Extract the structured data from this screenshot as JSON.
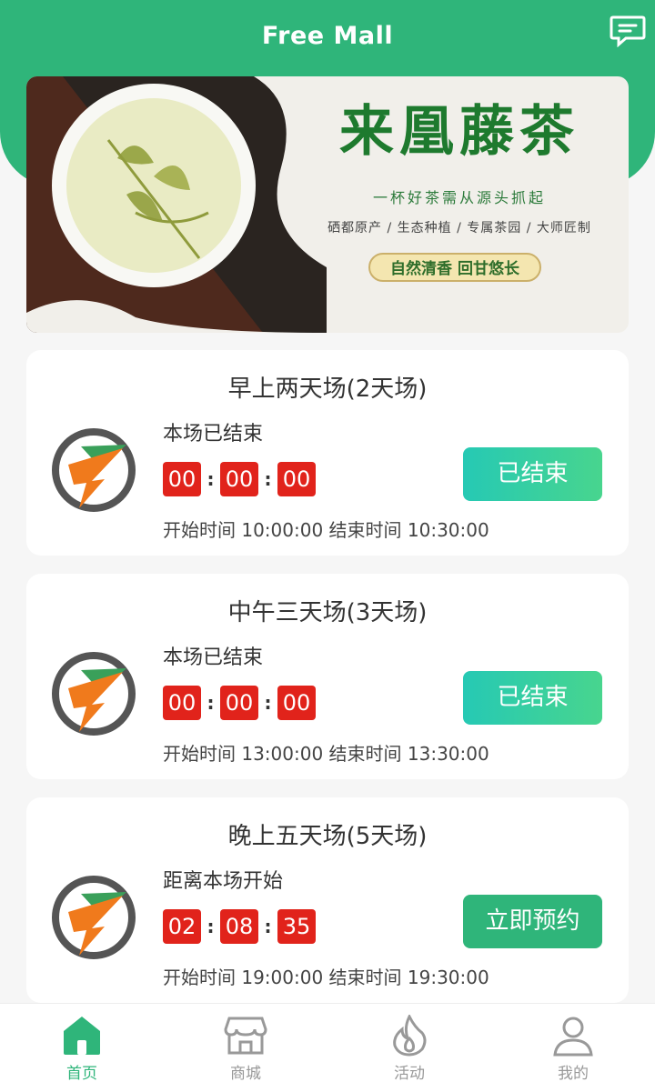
{
  "header": {
    "title": "Free Mall",
    "message_icon": "message-icon"
  },
  "banner": {
    "title": "来凰藤茶",
    "slogan": "一杯好茶需从源头抓起",
    "features": "硒都原产 / 生态种植 / 专属茶园 / 大师匠制",
    "tagline": "自然清香 回甘悠长"
  },
  "sessions": [
    {
      "title": "早上两天场(2天场)",
      "status": "本场已结束",
      "countdown": [
        "00",
        "00",
        "00"
      ],
      "time": "开始时间 10:00:00 结束时间 10:30:00",
      "button": "已结束"
    },
    {
      "title": "中午三天场(3天场)",
      "status": "本场已结束",
      "countdown": [
        "00",
        "00",
        "00"
      ],
      "time": "开始时间 13:00:00 结束时间 13:30:00",
      "button": "已结束"
    },
    {
      "title": "晚上五天场(5天场)",
      "status": "距离本场开始",
      "countdown": [
        "02",
        "08",
        "35"
      ],
      "time": "开始时间 19:00:00 结束时间 19:30:00",
      "button": "立即预约"
    }
  ],
  "tabs": [
    {
      "label": "首页",
      "icon": "home-icon",
      "active": true
    },
    {
      "label": "商城",
      "icon": "store-icon",
      "active": false
    },
    {
      "label": "活动",
      "icon": "fire-icon",
      "active": false
    },
    {
      "label": "我的",
      "icon": "user-icon",
      "active": false
    }
  ],
  "colors": {
    "brand": "#2fb57a",
    "digit_bg": "#e1231b",
    "ended_btn": "#26c9b4"
  }
}
